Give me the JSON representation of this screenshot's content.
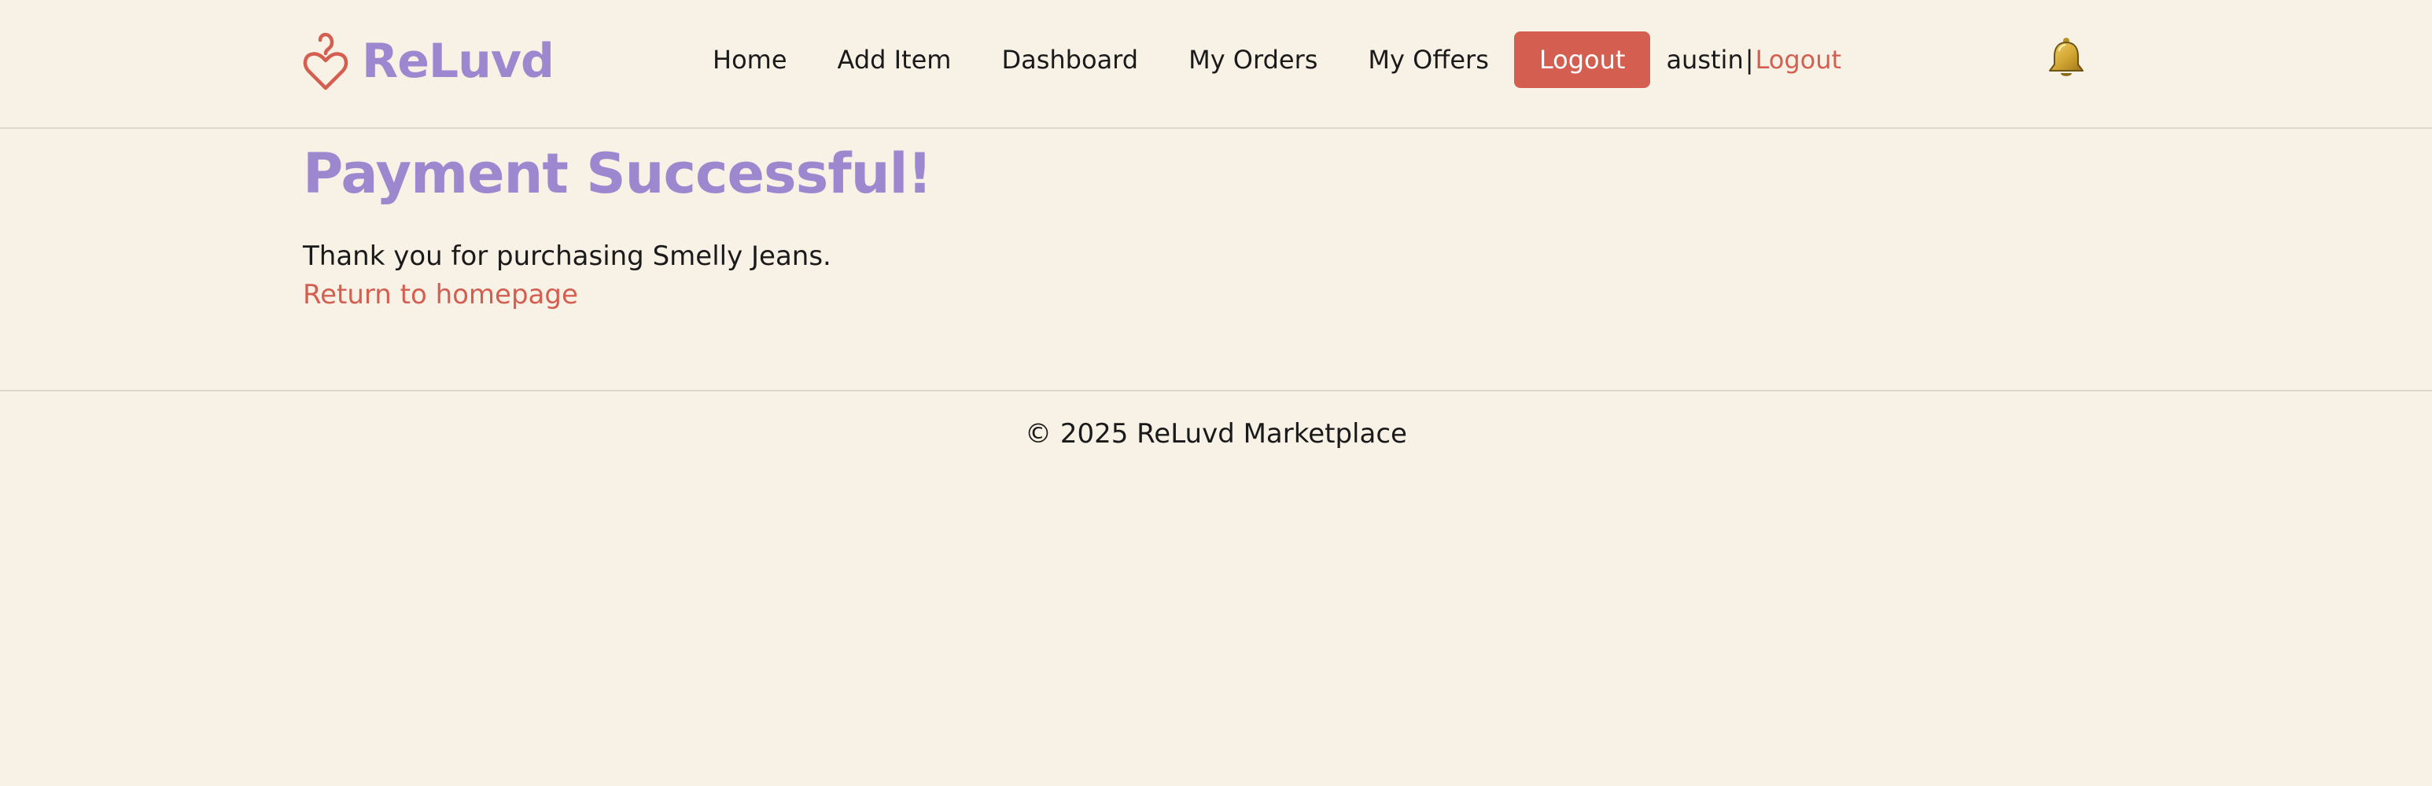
{
  "header": {
    "brand_name": "ReLuvd",
    "nav": {
      "home": "Home",
      "add_item": "Add Item",
      "dashboard": "Dashboard",
      "my_orders": "My Orders",
      "my_offers": "My Offers"
    },
    "logout_button": "Logout",
    "user": {
      "username": "austin",
      "separator": "|",
      "logout_link": "Logout"
    },
    "notification_icon": "bell-icon"
  },
  "main": {
    "title": "Payment Successful!",
    "message": "Thank you for purchasing Smelly Jeans.",
    "return_link": "Return to homepage"
  },
  "footer": {
    "copyright": "© 2025 ReLuvd Marketplace"
  },
  "colors": {
    "background": "#f8f1e6",
    "brand_purple": "#9d87cf",
    "accent_red": "#d45f51",
    "text": "#1a1a1a",
    "divider": "#dcd8cf"
  }
}
